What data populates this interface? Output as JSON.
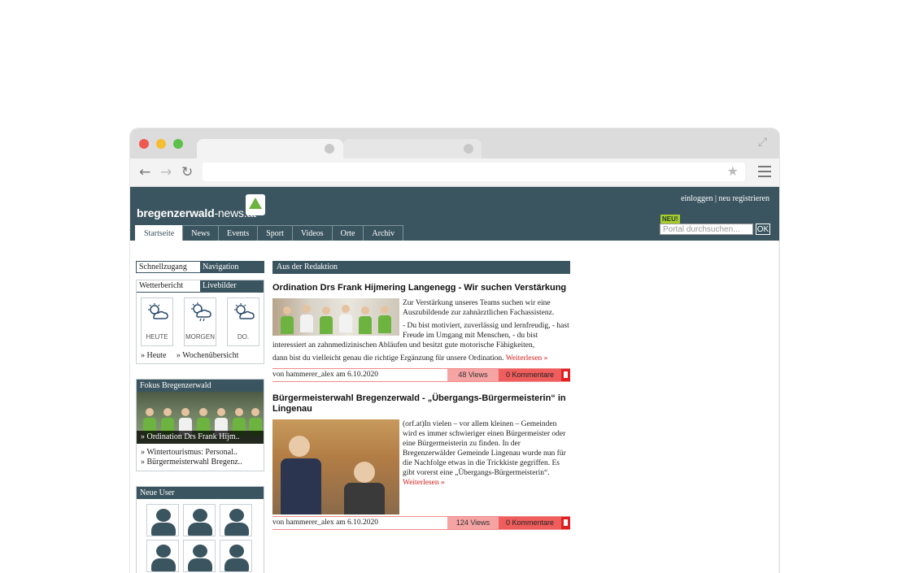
{
  "browser": {
    "url": "",
    "icons": [
      "back-arrow-icon",
      "forward-arrow-icon",
      "reload-icon",
      "star-icon",
      "menu-icon",
      "expand-icon"
    ]
  },
  "site": {
    "logo_bold": "bregenzerwald",
    "logo_light": "-news.at",
    "login": "einloggen",
    "separator": " | ",
    "register": "neu registrieren",
    "neu_badge": "NEU!",
    "search_placeholder": "Portal durchsuchen...",
    "search_button": "OK",
    "nav": [
      "Startseite",
      "News",
      "Events",
      "Sport",
      "Videos",
      "Orte",
      "Archiv"
    ]
  },
  "sidebar": {
    "tabs1": [
      "Schnellzugang",
      "Navigation"
    ],
    "tabs2": [
      "Wetterbericht",
      "Livebilder"
    ],
    "weather": [
      {
        "label": "HEUTE",
        "icon": "sun-cloud-icon"
      },
      {
        "label": "MORGEN",
        "icon": "sun-cloud-rain-icon"
      },
      {
        "label": "DO.",
        "icon": "sun-cloud-icon"
      }
    ],
    "weather_links": [
      "» Heute",
      "» Wochenübersicht"
    ],
    "fokus_title": "Fokus Bregenzerwald",
    "fokus_caption": "» Ordination Drs Frank Hijm..",
    "fokus_links": [
      "» Wintertourismus: Personal..",
      "» Bürgermeisterwahl Bregenz.."
    ],
    "users_title": "Neue User"
  },
  "main": {
    "header": "Aus der Redaktion",
    "articles": [
      {
        "title": "Ordination Drs Frank Hijmering Langenegg - Wir suchen Verstärkung",
        "p1": "Zur Verstärkung unseres Teams suchen wir eine Auszubildende zur zahnärztlichen Fachassistenz.",
        "p2": "- Du bist motiviert, zuverlässig und lernfreudig, - hast Freude im Umgang mit Menschen, - du bist interessiert an zahnmedizinischen Abläufen und besitzt gute motorische Fähigkeiten,",
        "p3": "dann bist du vielleicht genau die richtige Ergänzung für unsere Ordination.",
        "more": "Weiterlesen »",
        "byline": "von hammerer_alex am 6.10.2020",
        "views": "48 Views",
        "comments": "0 Kommentare"
      },
      {
        "title": "Bürgermeisterwahl Bregenzerwald - „Übergangs-Bürgermeisterin“ in Lingenau",
        "p1": "(orf.at)In vielen – vor allem kleinen – Gemeinden wird es immer schwieriger einen Bürgermeister oder eine Bürgermeisterin zu finden. In der Bregenzerwälder Gemeinde Lingenau wurde nun für die Nachfolge etwas in die Trickkiste gegriffen. Es gibt vorerst eine „Übergangs-Bürgermeisterin“.",
        "more": "Weiterlesen »",
        "byline": "von hammerer_alex am 6.10.2020",
        "views": "124 Views",
        "comments": "0 Kommentare"
      }
    ]
  },
  "colors": {
    "header_bg": "#3b5560",
    "accent_red": "#d31d1d",
    "neu_green": "#a7cc2e"
  }
}
